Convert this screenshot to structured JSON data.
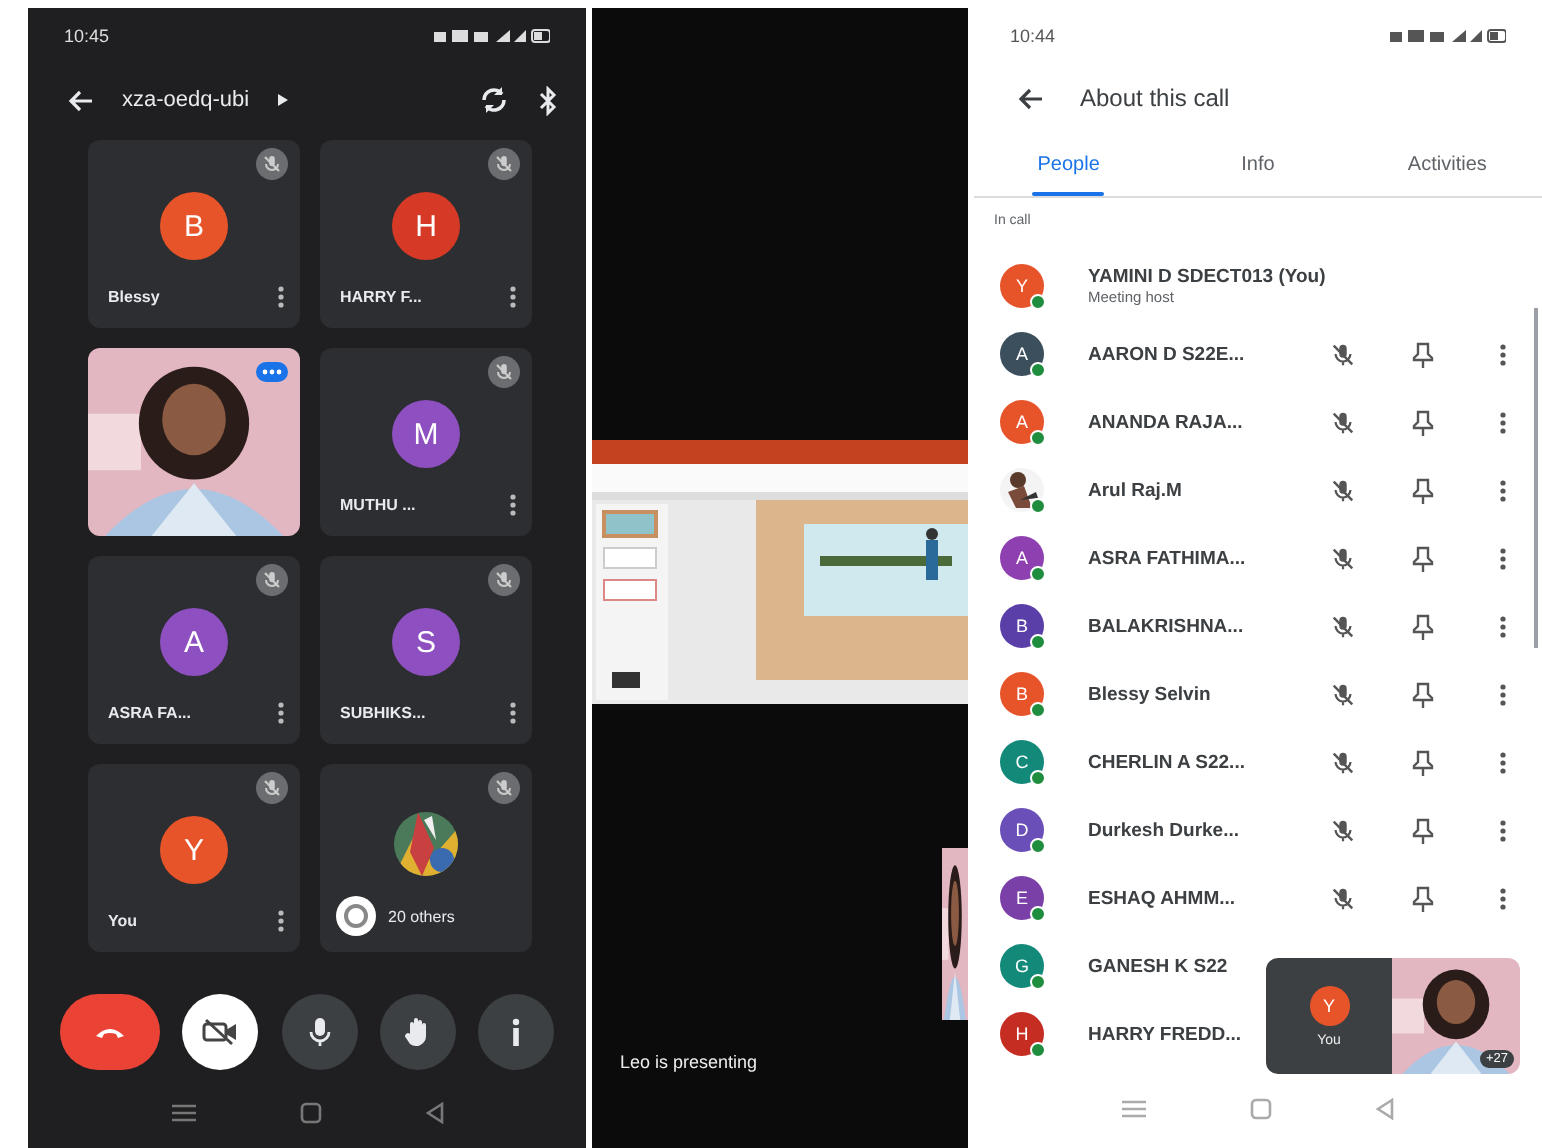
{
  "meeting_screen": {
    "status_time": "10:45",
    "title": "xza-oedq-ubi",
    "camera_on": false,
    "tiles": [
      {
        "kind": "avatar",
        "initial": "B",
        "color": "#e8542a",
        "name": "Blessy"
      },
      {
        "kind": "avatar",
        "initial": "H",
        "color": "#d63a26",
        "name": "HARRY F..."
      },
      {
        "kind": "video"
      },
      {
        "kind": "avatar",
        "initial": "M",
        "color": "#8e4fc0",
        "name": "MUTHU ..."
      },
      {
        "kind": "avatar",
        "initial": "A",
        "color": "#8e4fc0",
        "name": "ASRA FA..."
      },
      {
        "kind": "avatar",
        "initial": "S",
        "color": "#8e4fc0",
        "name": "SUBHIKS..."
      },
      {
        "kind": "avatar",
        "initial": "Y",
        "color": "#e8542a",
        "name": "You"
      },
      {
        "kind": "others",
        "label": "20 others"
      }
    ]
  },
  "presentation_screen": {
    "presenter_label": "Leo is presenting"
  },
  "details_screen": {
    "status_time": "10:44",
    "title": "About this call",
    "tabs": [
      {
        "label": "People",
        "selected": true
      },
      {
        "label": "Info",
        "selected": false
      },
      {
        "label": "Activities",
        "selected": false
      }
    ],
    "section_label": "In call",
    "participants": [
      {
        "kind": "host",
        "photo": false,
        "initial": "Y",
        "color": "#e8542a",
        "name": "YAMINI D SDECT013 (You)",
        "role": "Meeting host"
      },
      {
        "kind": "member",
        "photo": false,
        "initial": "A",
        "color": "#3c4f5c",
        "name": "AARON D S22E..."
      },
      {
        "kind": "member",
        "photo": false,
        "initial": "A",
        "color": "#e8542a",
        "name": "ANANDA RAJA..."
      },
      {
        "kind": "member",
        "photo": true,
        "name": "Arul Raj.M"
      },
      {
        "kind": "member",
        "photo": false,
        "initial": "A",
        "color": "#8e3fb0",
        "name": "ASRA FATHIMA..."
      },
      {
        "kind": "member",
        "photo": false,
        "initial": "B",
        "color": "#5a3fa8",
        "name": "BALAKRISHNA..."
      },
      {
        "kind": "member",
        "photo": false,
        "initial": "B",
        "color": "#e8542a",
        "name": "Blessy Selvin"
      },
      {
        "kind": "member",
        "photo": false,
        "initial": "C",
        "color": "#13897a",
        "name": "CHERLIN A S22..."
      },
      {
        "kind": "member",
        "photo": false,
        "initial": "D",
        "color": "#6a4fb8",
        "name": "Durkesh Durke..."
      },
      {
        "kind": "member",
        "photo": false,
        "initial": "E",
        "color": "#7b3fa8",
        "name": "ESHAQ AHMM..."
      },
      {
        "kind": "covered",
        "photo": false,
        "initial": "G",
        "color": "#13897a",
        "name": "GANESH K S22"
      },
      {
        "kind": "covered",
        "photo": false,
        "initial": "H",
        "color": "#c62d22",
        "name": "HARRY FREDD..."
      }
    ],
    "self_view": {
      "initial": "Y",
      "label": "You",
      "count": "+27"
    }
  }
}
